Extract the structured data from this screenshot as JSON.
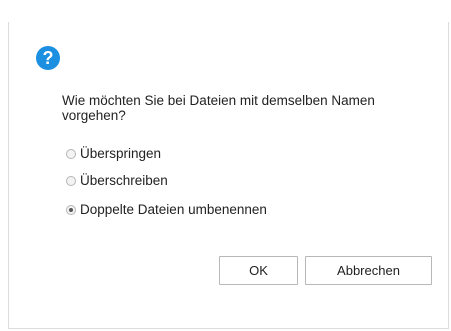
{
  "dialog": {
    "question": "Wie möchten Sie bei Dateien mit demselben Namen vorgehen?",
    "options": [
      {
        "label": "Überspringen",
        "selected": false
      },
      {
        "label": "Überschreiben",
        "selected": false
      },
      {
        "label": "Doppelte Dateien umbenennen",
        "selected": true
      }
    ],
    "buttons": {
      "ok": "OK",
      "cancel": "Abbrechen"
    },
    "icon": "help-question-icon",
    "colors": {
      "icon_bg": "#1c8fe0"
    }
  }
}
